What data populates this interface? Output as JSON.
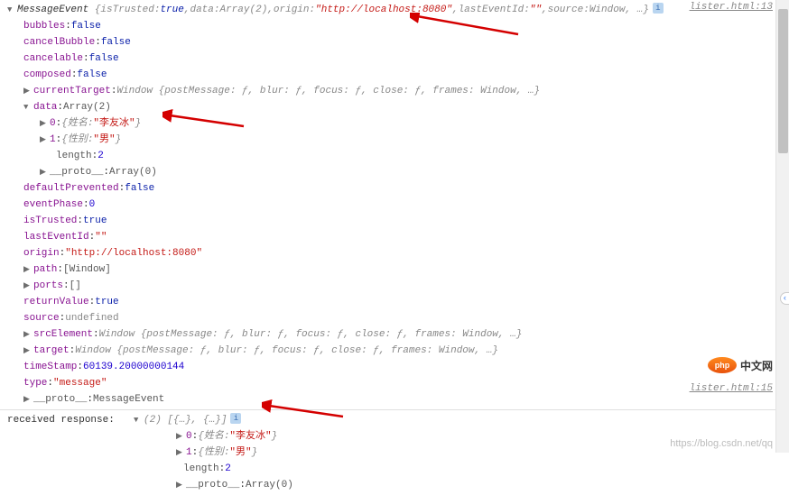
{
  "source_link_1": "lister.html:13",
  "source_link_2": "lister.html:15",
  "header": {
    "class": "MessageEvent",
    "isTrusted_key": "isTrusted",
    "isTrusted_val": "true",
    "data_key": "data",
    "data_val": "Array(2)",
    "origin_key": "origin",
    "origin_val": "\"http://localhost:8080\"",
    "lastEventId_key": "lastEventId",
    "lastEventId_val": "\"\"",
    "source_key": "source",
    "source_val": "Window",
    "rest": ", …}"
  },
  "props": {
    "bubbles_key": "bubbles",
    "bubbles_val": "false",
    "cancelBubble_key": "cancelBubble",
    "cancelBubble_val": "false",
    "cancelable_key": "cancelable",
    "cancelable_val": "false",
    "composed_key": "composed",
    "composed_val": "false",
    "currentTarget_key": "currentTarget",
    "currentTarget_val": "Window {postMessage: ƒ, blur: ƒ, focus: ƒ, close: ƒ, frames: Window, …}",
    "data_key": "data",
    "data_val": "Array(2)",
    "d0_key": "0",
    "d0_preview": "{姓名: ",
    "d0_val": "\"李友冰\"",
    "d0_close": "}",
    "d1_key": "1",
    "d1_preview": "{性别: ",
    "d1_val": "\"男\"",
    "d1_close": "}",
    "length_key": "length",
    "length_val": "2",
    "proto_arr_key": "__proto__",
    "proto_arr_val": "Array(0)",
    "defaultPrevented_key": "defaultPrevented",
    "defaultPrevented_val": "false",
    "eventPhase_key": "eventPhase",
    "eventPhase_val": "0",
    "isTrusted_key": "isTrusted",
    "isTrusted_val": "true",
    "lastEventId_key": "lastEventId",
    "lastEventId_val": "\"\"",
    "origin_key": "origin",
    "origin_val": "\"http://localhost:8080\"",
    "path_key": "path",
    "path_val": "[Window]",
    "ports_key": "ports",
    "ports_val": "[]",
    "returnValue_key": "returnValue",
    "returnValue_val": "true",
    "source_key": "source",
    "source_val": "undefined",
    "srcElement_key": "srcElement",
    "srcElement_val": "Window {postMessage: ƒ, blur: ƒ, focus: ƒ, close: ƒ, frames: Window, …}",
    "target_key": "target",
    "target_val": "Window {postMessage: ƒ, blur: ƒ, focus: ƒ, close: ƒ, frames: Window, …}",
    "timeStamp_key": "timeStamp",
    "timeStamp_val": "60139.20000000144",
    "type_key": "type",
    "type_val": "\"message\"",
    "proto_key": "__proto__",
    "proto_val": "MessageEvent"
  },
  "response": {
    "label": "received response:  ",
    "summary": "(2) [{…}, {…}]",
    "d0_key": "0",
    "d0_preview": "{姓名: ",
    "d0_val": "\"李友冰\"",
    "d0_close": "}",
    "d1_key": "1",
    "d1_preview": "{性别: ",
    "d1_val": "\"男\"",
    "d1_close": "}",
    "length_key": "length",
    "length_val": "2",
    "proto_key": "__proto__",
    "proto_val": "Array(0)"
  },
  "badge": {
    "php": "php",
    "text": "中文网"
  },
  "watermark": "https://blog.csdn.net/qq"
}
